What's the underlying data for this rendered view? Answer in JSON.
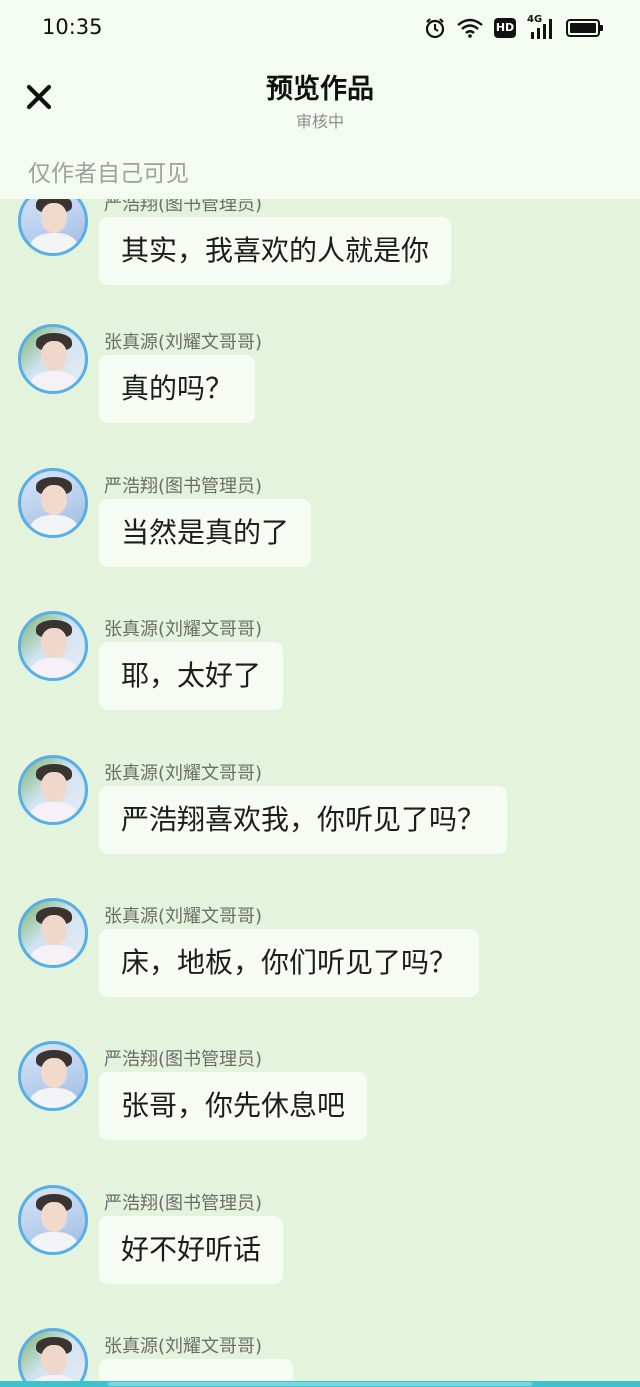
{
  "status": {
    "time": "10:35",
    "icons": [
      "alarm-icon",
      "wifi-icon",
      "hd-icon",
      "signal-4g-icon",
      "battery-icon"
    ],
    "hd_label": "HD",
    "network_label": "4G"
  },
  "header": {
    "title": "预览作品",
    "subtitle": "审核中",
    "visibility_note": "仅作者自己可见",
    "close_icon": "close-icon"
  },
  "messages": [
    {
      "sender": "严浩翔(图书管理员)",
      "text": "其实，我喜欢的人就是你"
    },
    {
      "sender": "张真源(刘耀文哥哥)",
      "text": "真的吗？"
    },
    {
      "sender": "严浩翔(图书管理员)",
      "text": "当然是真的了"
    },
    {
      "sender": "张真源(刘耀文哥哥)",
      "text": "耶，太好了"
    },
    {
      "sender": "张真源(刘耀文哥哥)",
      "text": "严浩翔喜欢我，你听见了吗？"
    },
    {
      "sender": "张真源(刘耀文哥哥)",
      "text": "床，地板，你们听见了吗？"
    },
    {
      "sender": "严浩翔(图书管理员)",
      "text": "张哥，你先休息吧"
    },
    {
      "sender": "严浩翔(图书管理员)",
      "text": "好不好听话"
    },
    {
      "sender": "张真源(刘耀文哥哥)",
      "text": ""
    }
  ],
  "colors": {
    "background": "#e4f4dc",
    "header": "#f4fbf1",
    "bubble": "#f6fbf3",
    "avatar_ring": "#58aee6",
    "bottom_bar": "#3cc3cf"
  }
}
